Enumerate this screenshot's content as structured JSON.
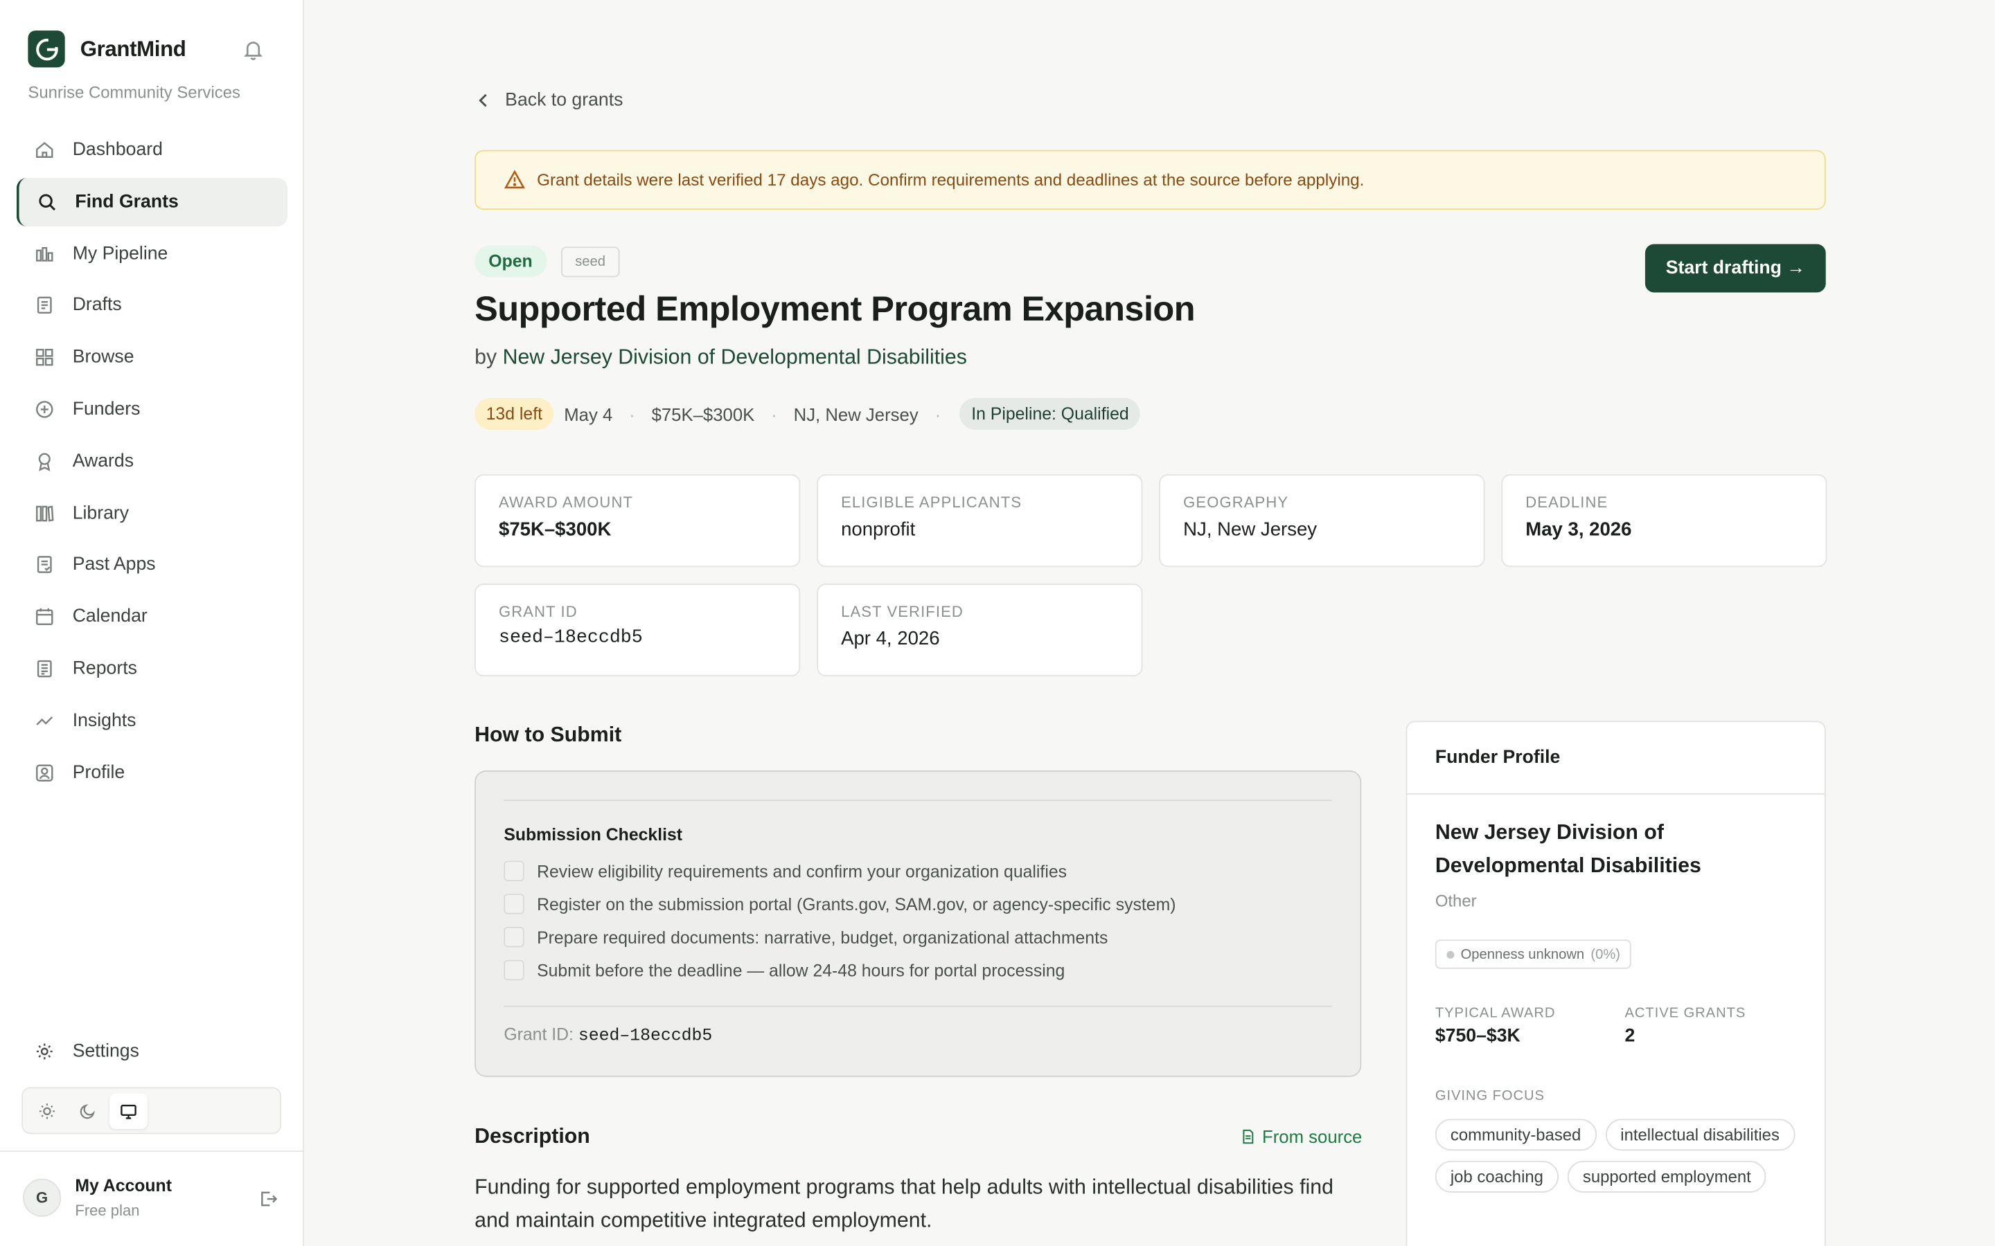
{
  "app": {
    "name": "GrantMind",
    "org": "Sunrise Community Services"
  },
  "sidebar": {
    "items": [
      {
        "label": "Dashboard"
      },
      {
        "label": "Find Grants"
      },
      {
        "label": "My Pipeline"
      },
      {
        "label": "Drafts"
      },
      {
        "label": "Browse"
      },
      {
        "label": "Funders"
      },
      {
        "label": "Awards"
      },
      {
        "label": "Library"
      },
      {
        "label": "Past Apps"
      },
      {
        "label": "Calendar"
      },
      {
        "label": "Reports"
      },
      {
        "label": "Insights"
      },
      {
        "label": "Profile"
      }
    ],
    "settings": "Settings",
    "account": {
      "initial": "G",
      "name": "My Account",
      "plan": "Free plan"
    }
  },
  "page": {
    "back": "Back to grants",
    "alert": "Grant details were last verified 17 days ago. Confirm requirements and deadlines at the source before applying.",
    "status": "Open",
    "source_tag": "seed",
    "title": "Supported Employment Program Expansion",
    "by_prefix": "by",
    "funder": "New Jersey Division of Developmental Disabilities",
    "cta": "Start drafting →",
    "meta": {
      "days_left": "13d left",
      "date": "May 4",
      "amount": "$75K–$300K",
      "location": "NJ, New Jersey",
      "pipeline": "In Pipeline: Qualified"
    },
    "cards": [
      {
        "label": "Award Amount",
        "value": "$75K–$300K"
      },
      {
        "label": "Eligible Applicants",
        "value": "nonprofit"
      },
      {
        "label": "Geography",
        "value": "NJ, New Jersey"
      },
      {
        "label": "Deadline",
        "value": "May 3, 2026"
      },
      {
        "label": "Grant ID",
        "value": "seed–18eccdb5"
      },
      {
        "label": "Last Verified",
        "value": "Apr 4, 2026"
      }
    ],
    "how_to_submit": {
      "heading": "How to Submit",
      "checklist_title": "Submission Checklist",
      "items": [
        "Review eligibility requirements and confirm your organization qualifies",
        "Register on the submission portal (Grants.gov, SAM.gov, or agency-specific system)",
        "Prepare required documents: narrative, budget, organizational attachments",
        "Submit before the deadline — allow 24-48 hours for portal processing"
      ],
      "grant_id_label": "Grant ID:",
      "grant_id": "seed–18eccdb5"
    },
    "description": {
      "heading": "Description",
      "from_source": "From source",
      "text": "Funding for supported employment programs that help adults with intellectual disabilities find and maintain competitive integrated employment."
    }
  },
  "funder_profile": {
    "heading": "Funder Profile",
    "name": "New Jersey Division of Developmental Disabilities",
    "type": "Other",
    "openness": "Openness unknown",
    "openness_pct": "(0%)",
    "typical_award_label": "Typical Award",
    "typical_award": "$750–$3K",
    "active_grants_label": "Active Grants",
    "active_grants": "2",
    "giving_focus_label": "Giving Focus",
    "tags": [
      "community-based",
      "intellectual disabilities",
      "job coaching",
      "supported employment"
    ]
  },
  "colors": {
    "brand": "#1d4a36",
    "warning_bg": "#fdf8e4",
    "open_badge": "#e4f5ea",
    "from_source": "#1f7a45"
  }
}
